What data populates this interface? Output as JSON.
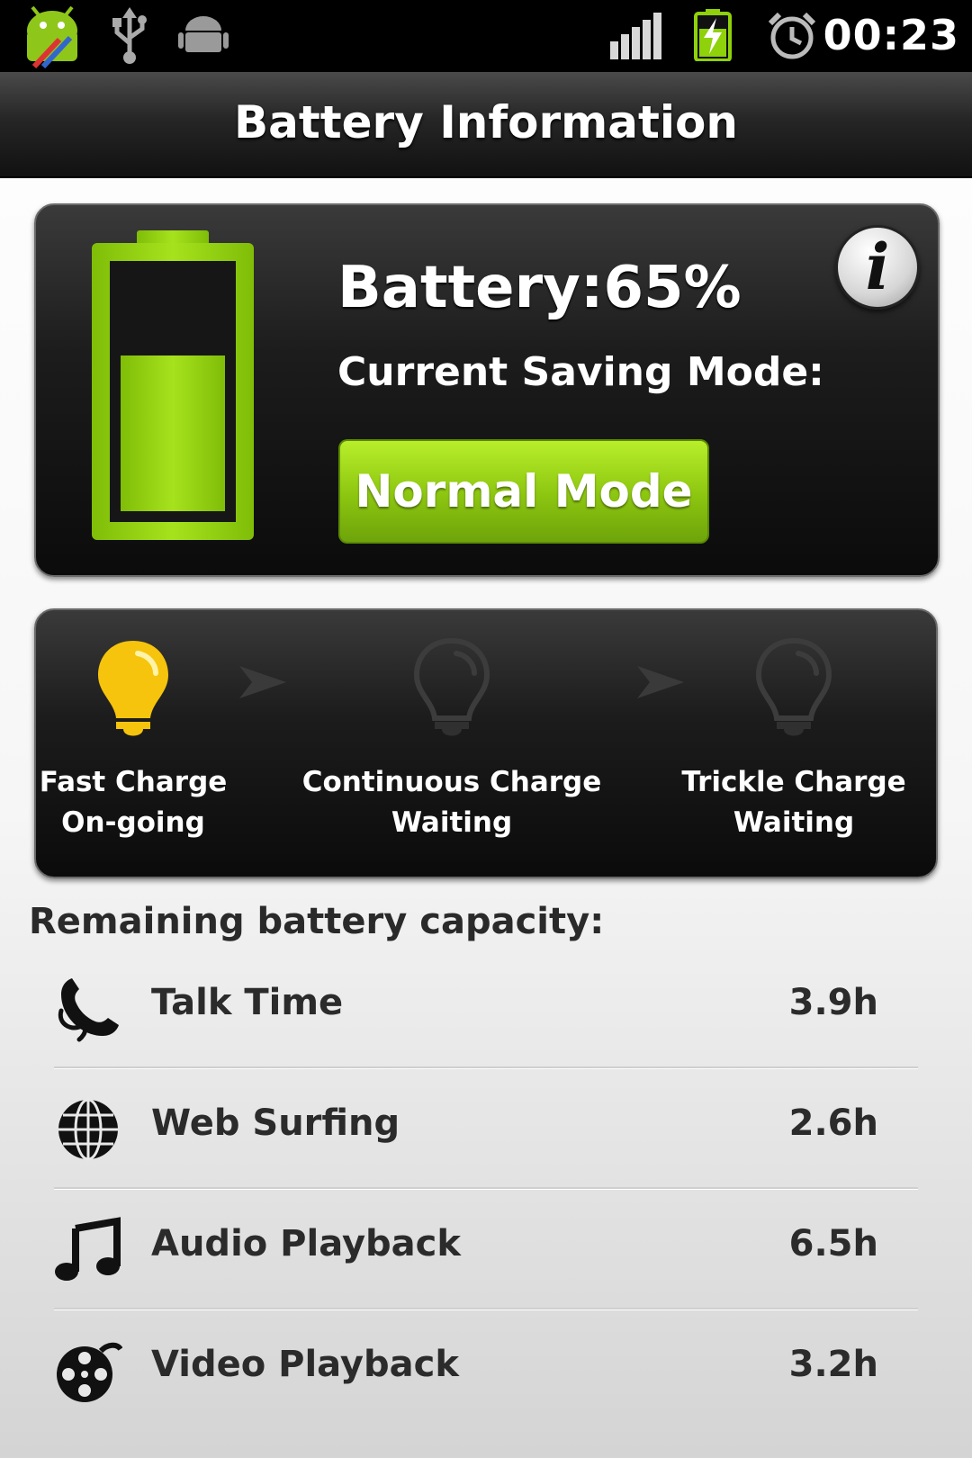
{
  "status_bar": {
    "time": "00:23",
    "icons": [
      "android-debug-icon",
      "usb-icon",
      "android-icon",
      "signal-icon",
      "battery-charging-icon",
      "alarm-icon"
    ]
  },
  "header": {
    "title": "Battery Information"
  },
  "battery": {
    "label": "Battery:65%",
    "level_percent": 65,
    "mode_label": "Current Saving Mode:",
    "mode_button_label": "Normal Mode",
    "colors": {
      "battery_green": "#8fd10a",
      "mode_button": "#8cc510"
    }
  },
  "charge_stages": [
    {
      "name": "Fast Charge",
      "status": "On-going",
      "active": true,
      "icon": "lightbulb-icon"
    },
    {
      "name": "Continuous Charge",
      "status": "Waiting",
      "active": false,
      "icon": "lightbulb-icon"
    },
    {
      "name": "Trickle Charge",
      "status": "Waiting",
      "active": false,
      "icon": "lightbulb-icon"
    }
  ],
  "capacity": {
    "heading": "Remaining battery capacity:",
    "items": [
      {
        "label": "Talk Time",
        "value": "3.9h",
        "icon": "phone-icon"
      },
      {
        "label": "Web Surfing",
        "value": "2.6h",
        "icon": "globe-icon"
      },
      {
        "label": "Audio Playback",
        "value": "6.5h",
        "icon": "music-note-icon"
      },
      {
        "label": "Video Playback",
        "value": "3.2h",
        "icon": "film-reel-icon"
      }
    ]
  }
}
